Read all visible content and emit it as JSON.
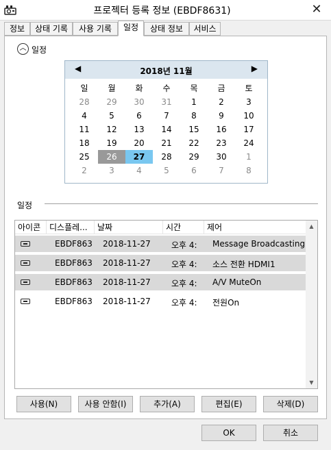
{
  "window": {
    "title": "프로젝터 등록 정보 (EBDF8631)",
    "close_glyph": "✕"
  },
  "tabs": [
    "정보",
    "상태 기록",
    "사용 기록",
    "일정",
    "상태 정보",
    "서비스"
  ],
  "section": {
    "collapse_glyph": "︿",
    "label": "일정"
  },
  "calendar": {
    "month_label": "2018년 11월",
    "prev": "◀",
    "next": "▶",
    "weekdays": [
      "일",
      "월",
      "화",
      "수",
      "목",
      "금",
      "토"
    ],
    "weeks": [
      [
        "28",
        "29",
        "30",
        "31",
        "1",
        "2",
        "3"
      ],
      [
        "4",
        "5",
        "6",
        "7",
        "8",
        "9",
        "10"
      ],
      [
        "11",
        "12",
        "13",
        "14",
        "15",
        "16",
        "17"
      ],
      [
        "18",
        "19",
        "20",
        "21",
        "22",
        "23",
        "24"
      ],
      [
        "25",
        "26",
        "27",
        "28",
        "29",
        "30",
        "1"
      ],
      [
        "2",
        "3",
        "4",
        "5",
        "6",
        "7",
        "8"
      ]
    ]
  },
  "schedule": {
    "group_label": "일정",
    "columns": [
      "아이콘",
      "디스플레...",
      "날짜",
      "시간",
      "제어"
    ],
    "rows": [
      {
        "display": "EBDF863",
        "date": "2018-11-27",
        "time": "오후 4:",
        "control": "Message Broadcasting"
      },
      {
        "display": "EBDF863",
        "date": "2018-11-27",
        "time": "오후 4:",
        "control": "소스 전환 HDMI1"
      },
      {
        "display": "EBDF863",
        "date": "2018-11-27",
        "time": "오후 4:",
        "control": "A/V MuteOn"
      },
      {
        "display": "EBDF863",
        "date": "2018-11-27",
        "time": "오후 4:",
        "control": "전원On"
      }
    ],
    "scroll_up": "▲",
    "scroll_down": "▼"
  },
  "actions": {
    "enable": "사용(N)",
    "disable": "사용 안함(I)",
    "add": "추가(A)",
    "edit": "편집(E)",
    "delete": "삭제(D)"
  },
  "dialog": {
    "ok": "OK",
    "cancel": "취소"
  },
  "colors": {
    "today": "#79c7f0",
    "selected_day": "#999999",
    "selected_row": "#d9d9d9"
  }
}
